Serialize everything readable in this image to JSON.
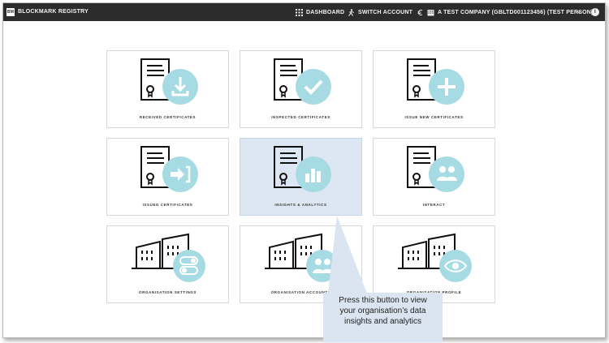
{
  "topbar": {
    "logo_text": "BM",
    "app_title": "BLOCKMARK REGISTRY",
    "dashboard_label": "DASHBOARD",
    "switch_account_label": "SWITCH ACCOUNT",
    "account_label": "A TEST COMPANY (GBLTD001123456) (TEST PERSON)",
    "chevron": "⌄",
    "info_glyph": "i"
  },
  "tiles": [
    {
      "label": "RECEIVED CERTIFICATES",
      "icon": "download-icon"
    },
    {
      "label": "INSPECTED CERTIFICATES",
      "icon": "check-icon"
    },
    {
      "label": "ISSUE NEW CERTIFICATES",
      "icon": "plus-icon"
    },
    {
      "label": "ISSUED CERTIFICATES",
      "icon": "export-icon"
    },
    {
      "label": "INSIGHTS & ANALYTICS",
      "icon": "bar-chart-icon"
    },
    {
      "label": "INTERACT",
      "icon": "people-icon"
    },
    {
      "label": "ORGANISATION SETTINGS",
      "icon": "toggle-icon"
    },
    {
      "label": "ORGANISATION ACCOUNTS",
      "icon": "people-icon"
    },
    {
      "label": "ORGANISATION PROFILE",
      "icon": "eye-icon"
    }
  ],
  "callout": {
    "line1": "Press this button to view",
    "line2": "your organisation’s data",
    "line3": "insights and analytics"
  },
  "colors": {
    "topbar": "#2c2c2c",
    "badge": "#a6dbe4",
    "selected_tile": "#dde7f3",
    "callout": "#dbe5f1"
  }
}
